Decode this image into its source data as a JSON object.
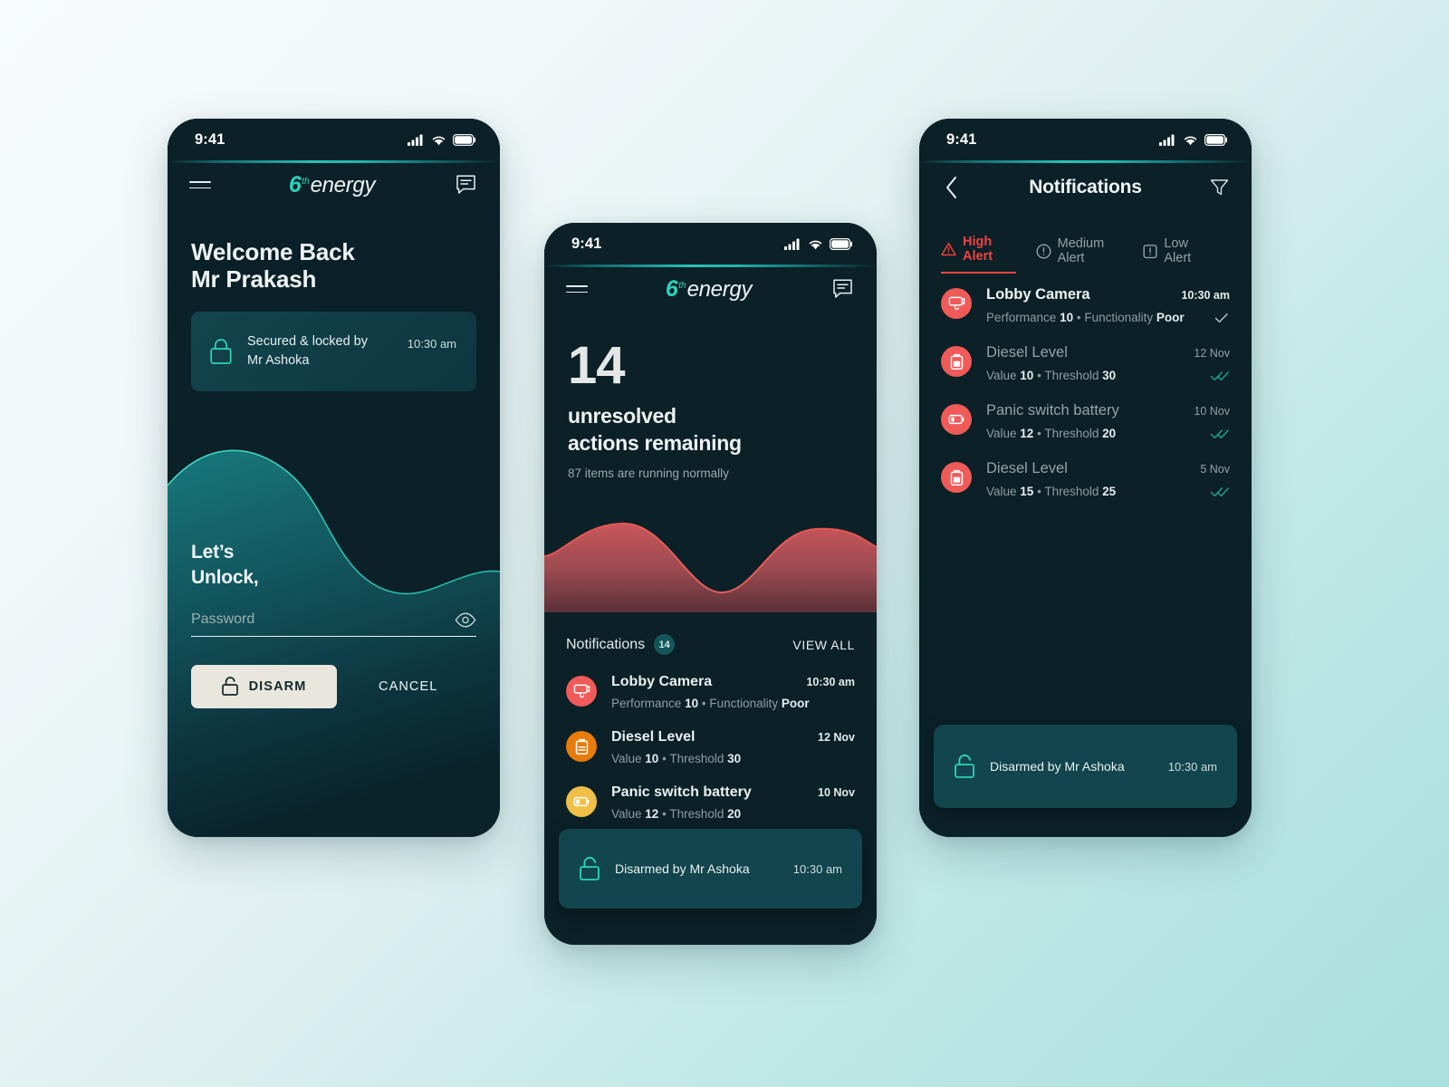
{
  "theme": {
    "accent_teal": "#2bd4bd",
    "alert_red": "#f0433f",
    "icon_red": "#f05a58",
    "icon_orange": "#e87b0a",
    "icon_yellow": "#f0bf47",
    "card_teal": "#12454d",
    "screen_bg": "#0b2027",
    "page_bg_from": "#f7fbfd",
    "page_bg_to": "#a9e0de"
  },
  "status_bar": {
    "time": "9:41",
    "signal_icon": "cellular-signal-icon",
    "wifi_icon": "wifi-icon",
    "battery_icon": "battery-icon"
  },
  "brand": {
    "numeral": "6",
    "superscript": "th",
    "word": "energy"
  },
  "screen1": {
    "menu_icon": "hamburger-menu-icon",
    "chat_icon": "chat-bubble-icon",
    "welcome_line1": "Welcome Back",
    "welcome_line2": "Mr Prakash",
    "secured_card": {
      "lock_icon": "lock-closed-icon",
      "line1": "Secured & locked by",
      "line2": "Mr Ashoka",
      "time": "10:30 am"
    },
    "unlock_line1": "Let’s",
    "unlock_line2": "Unlock,",
    "password": {
      "placeholder": "Password",
      "value": "",
      "toggle_icon": "eye-icon"
    },
    "disarm_label": "DISARM",
    "disarm_icon": "lock-open-icon",
    "cancel_label": "CANCEL"
  },
  "screen2": {
    "menu_icon": "hamburger-menu-icon",
    "chat_icon": "chat-bubble-icon",
    "count": "14",
    "headline_line1": "unresolved",
    "headline_line2": "actions remaining",
    "subnote": "87 items are running normally",
    "notifications_label": "Notifications",
    "notifications_badge": "14",
    "view_all_label": "VIEW ALL",
    "rows": [
      {
        "icon": "cctv-camera-icon",
        "icon_color": "#f05a58",
        "title": "Lobby Camera",
        "time": "10:30 am",
        "meta_label1": "Performance",
        "meta_value1": "10",
        "separator": "•",
        "meta_label2": "Functionality",
        "meta_value2": "Poor"
      },
      {
        "icon": "fuel-tank-icon",
        "icon_color": "#e87b0a",
        "title": "Diesel Level",
        "time": "12 Nov",
        "meta_label1": "Value",
        "meta_value1": "10",
        "separator": "•",
        "meta_label2": "Threshold",
        "meta_value2": "30"
      },
      {
        "icon": "battery-low-icon",
        "icon_color": "#f0bf47",
        "title": "Panic switch battery",
        "time": "10 Nov",
        "meta_label1": "Value",
        "meta_value1": "12",
        "separator": "•",
        "meta_label2": "Threshold",
        "meta_value2": "20"
      }
    ],
    "toast": {
      "icon": "lock-open-icon",
      "text": "Disarmed by Mr Ashoka",
      "time": "10:30 am"
    }
  },
  "screen3": {
    "back_icon": "chevron-left-icon",
    "title": "Notifications",
    "filter_icon": "filter-funnel-icon",
    "tabs": [
      {
        "label": "High Alert",
        "icon": "warning-triangle-icon",
        "active": true
      },
      {
        "label": "Medium Alert",
        "icon": "exclamation-circle-icon",
        "active": false
      },
      {
        "label": "Low Alert",
        "icon": "exclamation-square-icon",
        "active": false
      }
    ],
    "rows": [
      {
        "icon": "cctv-camera-icon",
        "icon_color": "#f05a58",
        "title": "Lobby Camera",
        "time": "10:30 am",
        "meta_label1": "Performance",
        "meta_value1": "10",
        "separator": "•",
        "meta_label2": "Functionality",
        "meta_value2": "Poor",
        "status_icon": "single-check-icon",
        "read": false
      },
      {
        "icon": "fuel-tank-icon",
        "icon_color": "#f05a58",
        "title": "Diesel Level",
        "time": "12 Nov",
        "meta_label1": "Value",
        "meta_value1": "10",
        "separator": "•",
        "meta_label2": "Threshold",
        "meta_value2": "30",
        "status_icon": "double-check-icon",
        "read": true
      },
      {
        "icon": "battery-low-icon",
        "icon_color": "#f05a58",
        "title": "Panic switch battery",
        "time": "10 Nov",
        "meta_label1": "Value",
        "meta_value1": "12",
        "separator": "•",
        "meta_label2": "Threshold",
        "meta_value2": "20",
        "status_icon": "double-check-icon",
        "read": true
      },
      {
        "icon": "fuel-tank-icon",
        "icon_color": "#f05a58",
        "title": "Diesel Level",
        "time": "5 Nov",
        "meta_label1": "Value",
        "meta_value1": "15",
        "separator": "•",
        "meta_label2": "Threshold",
        "meta_value2": "25",
        "status_icon": "double-check-icon",
        "read": true
      }
    ],
    "toast": {
      "icon": "lock-open-icon",
      "text": "Disarmed by Mr Ashoka",
      "time": "10:30 am"
    }
  }
}
